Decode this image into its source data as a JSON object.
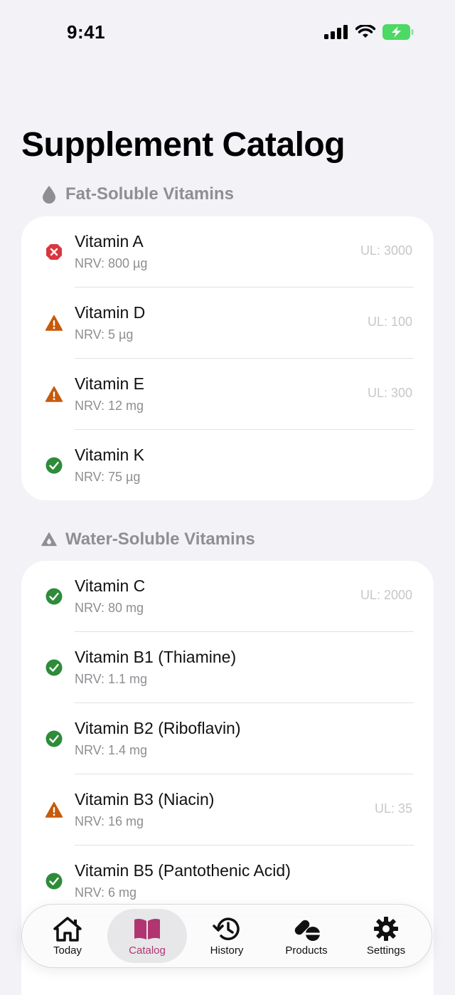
{
  "status_bar": {
    "time": "9:41"
  },
  "page": {
    "title": "Supplement Catalog"
  },
  "sections": [
    {
      "header": "Fat-Soluble Vitamins",
      "icon": "drop-icon",
      "items": [
        {
          "name": "Vitamin A",
          "nrv": "NRV: 800 µg",
          "ul": "UL: 3000",
          "status": "error"
        },
        {
          "name": "Vitamin D",
          "nrv": "NRV: 5 µg",
          "ul": "UL: 100",
          "status": "warning"
        },
        {
          "name": "Vitamin E",
          "nrv": "NRV: 12 mg",
          "ul": "UL: 300",
          "status": "warning"
        },
        {
          "name": "Vitamin K",
          "nrv": "NRV: 75 µg",
          "ul": "",
          "status": "ok"
        }
      ]
    },
    {
      "header": "Water-Soluble Vitamins",
      "icon": "drop-triangle-icon",
      "items": [
        {
          "name": "Vitamin C",
          "nrv": "NRV: 80 mg",
          "ul": "UL: 2000",
          "status": "ok"
        },
        {
          "name": "Vitamin B1 (Thiamine)",
          "nrv": "NRV: 1.1 mg",
          "ul": "",
          "status": "ok"
        },
        {
          "name": "Vitamin B2 (Riboflavin)",
          "nrv": "NRV: 1.4 mg",
          "ul": "",
          "status": "ok"
        },
        {
          "name": "Vitamin B3 (Niacin)",
          "nrv": "NRV: 16 mg",
          "ul": "UL: 35",
          "status": "warning"
        },
        {
          "name": "Vitamin B5 (Pantothenic Acid)",
          "nrv": "NRV: 6 mg",
          "ul": "",
          "status": "ok"
        }
      ]
    }
  ],
  "tab_bar": {
    "tabs": [
      {
        "label": "Today",
        "icon": "house-icon",
        "active": false
      },
      {
        "label": "Catalog",
        "icon": "book-icon",
        "active": true
      },
      {
        "label": "History",
        "icon": "clock-history-icon",
        "active": false
      },
      {
        "label": "Products",
        "icon": "pills-icon",
        "active": false
      },
      {
        "label": "Settings",
        "icon": "gear-icon",
        "active": false
      }
    ]
  },
  "colors": {
    "error": "#d9363e",
    "warning": "#c75a0b",
    "ok": "#2e8b3a",
    "accent": "#b03570"
  }
}
